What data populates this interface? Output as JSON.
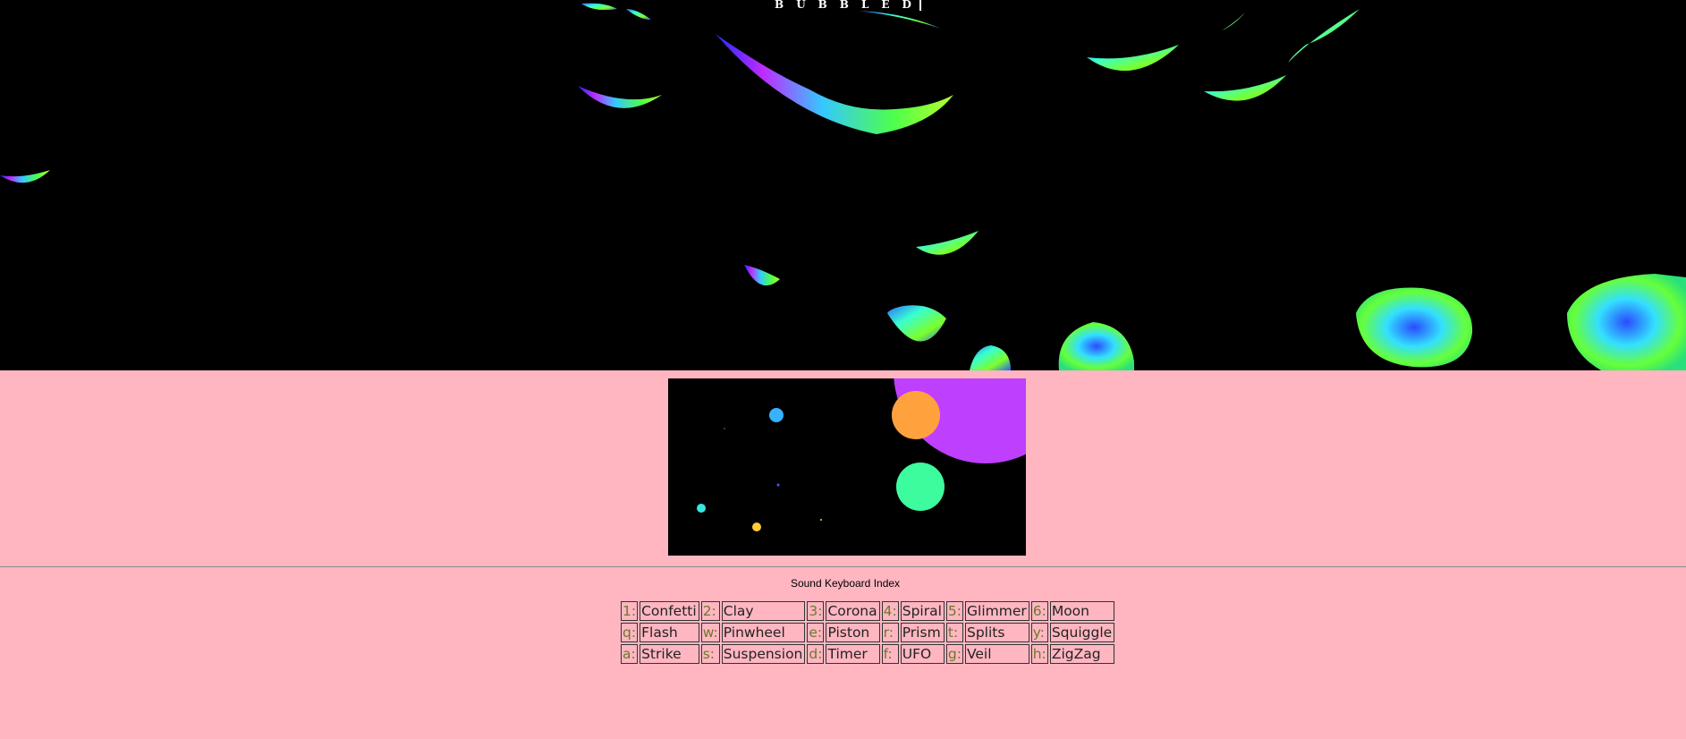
{
  "hero": {
    "title": "BUBBLED",
    "background": "#000000"
  },
  "preview": {
    "background": "#000000",
    "circle_colors": [
      "#bf3fff",
      "#ffa23e",
      "#3dfc9e",
      "#36b2ff",
      "#38e6e0",
      "#ffcc33"
    ]
  },
  "page_background": "#ffb6c1",
  "index": {
    "title": "Sound Keyboard Index",
    "rows": [
      [
        {
          "key": "1:",
          "name": "Confetti"
        },
        {
          "key": "2:",
          "name": "Clay"
        },
        {
          "key": "3:",
          "name": "Corona"
        },
        {
          "key": "4:",
          "name": "Spiral"
        },
        {
          "key": "5:",
          "name": "Glimmer"
        },
        {
          "key": "6:",
          "name": "Moon"
        }
      ],
      [
        {
          "key": "q:",
          "name": "Flash"
        },
        {
          "key": "w:",
          "name": "Pinwheel"
        },
        {
          "key": "e:",
          "name": "Piston"
        },
        {
          "key": "r:",
          "name": "Prism"
        },
        {
          "key": "t:",
          "name": "Splits"
        },
        {
          "key": "y:",
          "name": "Squiggle"
        }
      ],
      [
        {
          "key": "a:",
          "name": "Strike"
        },
        {
          "key": "s:",
          "name": "Suspension"
        },
        {
          "key": "d:",
          "name": "Timer"
        },
        {
          "key": "f:",
          "name": "UFO"
        },
        {
          "key": "g:",
          "name": "Veil"
        },
        {
          "key": "h:",
          "name": "ZigZag"
        }
      ]
    ]
  }
}
